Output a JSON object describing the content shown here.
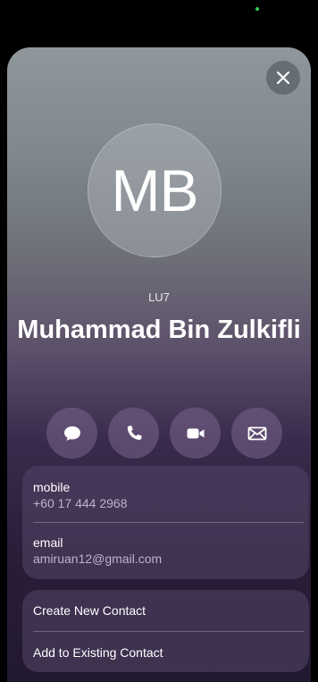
{
  "contact": {
    "initials": "MB",
    "subtitle": "LU7",
    "name": "Muhammad Bin Zulkifli"
  },
  "actions": [
    {
      "name": "message",
      "icon": "message-bubble-icon"
    },
    {
      "name": "call",
      "icon": "phone-icon"
    },
    {
      "name": "video",
      "icon": "video-camera-icon"
    },
    {
      "name": "mail",
      "icon": "envelope-icon"
    }
  ],
  "fields": {
    "mobile_label": "mobile",
    "mobile_value": "+60 17 444 2968",
    "email_label": "email",
    "email_value": "amiruan12@gmail.com"
  },
  "links": {
    "create": "Create New Contact",
    "add_existing": "Add to Existing Contact"
  },
  "colors": {
    "status_dot": "#2fd158",
    "sheet_top": "#8f979c",
    "sheet_bottom": "#221830"
  }
}
